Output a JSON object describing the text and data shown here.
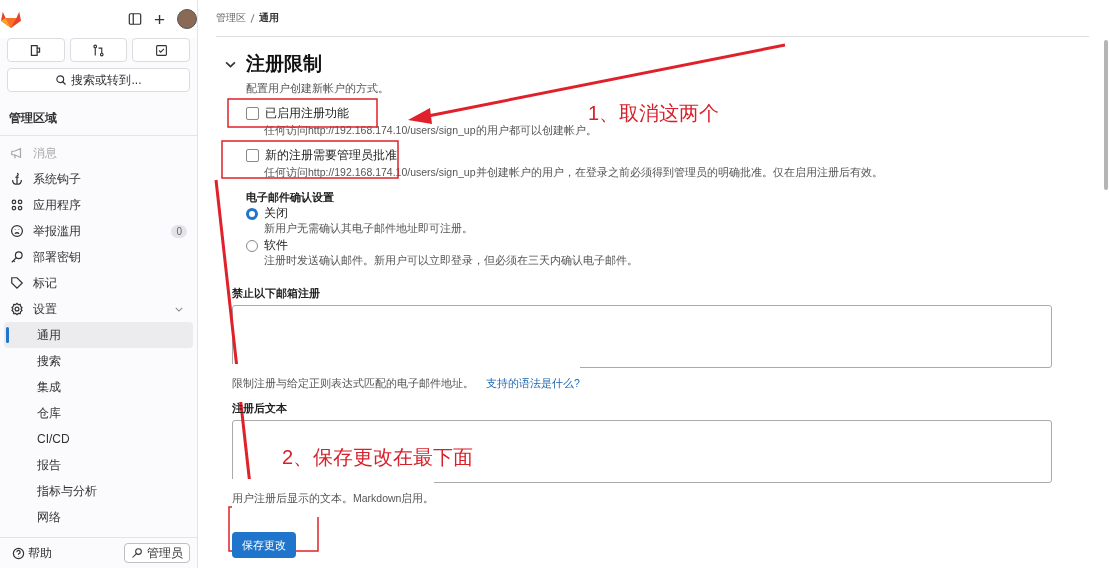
{
  "sidebar": {
    "new_label": "+",
    "search": {
      "placeholder": "搜索或转到..."
    },
    "section_title": "管理区域",
    "items": [
      {
        "label": "消息",
        "disabled": true
      },
      {
        "label": "系统钩子",
        "disabled": false
      },
      {
        "label": "应用程序",
        "disabled": false
      },
      {
        "label": "举报滥用",
        "disabled": false,
        "badge": "0"
      },
      {
        "label": "部署密钥",
        "disabled": false
      },
      {
        "label": "标记",
        "disabled": false
      },
      {
        "label": "设置",
        "disabled": false,
        "expanded": true,
        "children": [
          {
            "label": "通用",
            "selected": true
          },
          {
            "label": "搜索",
            "selected": false
          },
          {
            "label": "集成",
            "selected": false
          },
          {
            "label": "仓库",
            "selected": false
          },
          {
            "label": "CI/CD",
            "selected": false
          },
          {
            "label": "报告",
            "selected": false
          },
          {
            "label": "指标与分析",
            "selected": false
          },
          {
            "label": "网络",
            "selected": false
          }
        ]
      }
    ],
    "help": "帮助",
    "admin_button": "管理员"
  },
  "breadcrumb": [
    "管理区",
    "通用"
  ],
  "section": {
    "title": "注册限制",
    "expanded": true,
    "description": "配置用户创建新帐户的方式。",
    "checkboxes": [
      {
        "label": "已启用注册功能",
        "checked": false,
        "help": "任何访问http://192.168.174.10/users/sign_up的用户都可以创建帐户。"
      },
      {
        "label": "新的注册需要管理员批准",
        "checked": false,
        "help": "任何访问http://192.168.174.10/users/sign_up并创建帐户的用户，在登录之前必须得到管理员的明确批准。仅在启用注册后有效。"
      }
    ],
    "email_confirmation": {
      "label": "电子邮件确认设置",
      "options": [
        {
          "label": "关闭",
          "help": "新用户无需确认其电子邮件地址即可注册。",
          "selected": true
        },
        {
          "label": "软件",
          "help": "注册时发送确认邮件。新用户可以立即登录，但必须在三天内确认电子邮件。",
          "selected": false
        }
      ]
    },
    "denylist": {
      "label": "禁止以下邮箱注册",
      "help": "限制注册与给定正则表达式匹配的电子邮件地址。",
      "link": "支持的语法是什么?"
    },
    "after_signup": {
      "label": "注册后文本",
      "help": "用户注册后显示的文本。Markdown启用。"
    },
    "save_button": "保存更改"
  },
  "annotations": [
    "1、取消这两个",
    "2、保存更改在最下面"
  ]
}
